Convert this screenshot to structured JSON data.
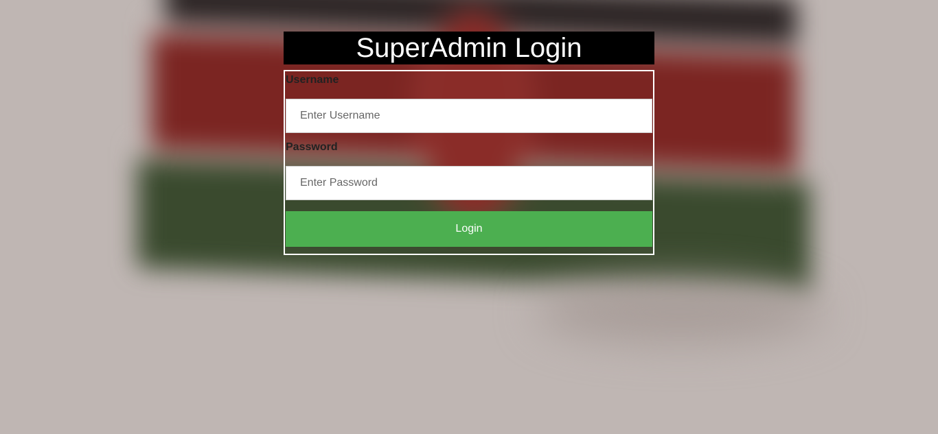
{
  "page": {
    "title": "SuperAdmin Login"
  },
  "form": {
    "username_label": "Username",
    "username_placeholder": "Enter Username",
    "username_value": "",
    "password_label": "Password",
    "password_placeholder": "Enter Password",
    "password_value": "",
    "login_label": "Login"
  },
  "colors": {
    "title_background": "#000000",
    "login_button": "#4caf50",
    "form_border": "#ffffff"
  }
}
